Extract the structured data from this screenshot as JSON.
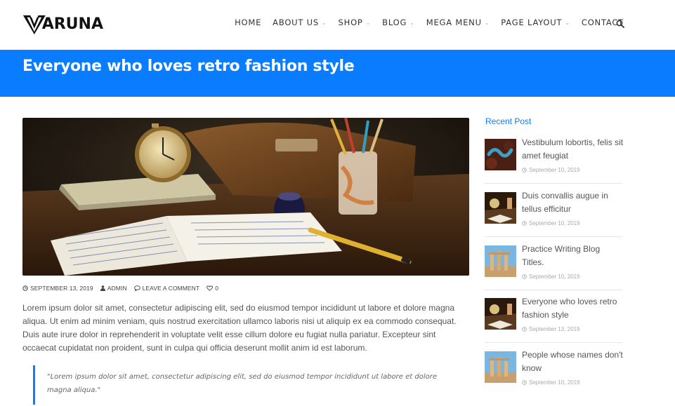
{
  "brand": {
    "name": "ARUNA"
  },
  "nav": [
    {
      "label": "HOME",
      "dropdown": false
    },
    {
      "label": "ABOUT US",
      "dropdown": true
    },
    {
      "label": "SHOP",
      "dropdown": true
    },
    {
      "label": "BLOG",
      "dropdown": true
    },
    {
      "label": "MEGA MENU",
      "dropdown": true
    },
    {
      "label": "PAGE LAYOUT",
      "dropdown": true
    },
    {
      "label": "CONTACT",
      "dropdown": false
    }
  ],
  "banner": {
    "title": "Everyone who loves retro fashion style"
  },
  "article": {
    "meta": {
      "date": "SEPTEMBER 13, 2019",
      "author": "ADMIN",
      "comment_link": "LEAVE A COMMENT",
      "likes": "0"
    },
    "body": "Lorem ipsum dolor sit amet, consectetur adipiscing elit, sed do eiusmod tempor incididunt ut labore et dolore magna aliqua. Ut enim ad minim veniam, quis nostrud exercitation ullamco laboris nisi ut aliquip ex ea commodo consequat. Duis aute irure dolor in reprehenderit in voluptate velit esse cillum dolore eu fugiat nulla pariatur. Excepteur sint occaecat cupidatat non proident, sunt in culpa qui officia deserunt mollit anim id est laborum.",
    "quote": "\"Lorem ipsum dolor sit amet, consectetur adipiscing elit, sed do eiusmod tempor incididunt ut labore et dolore magna aliqua.\""
  },
  "sidebar": {
    "title": "Recent Post",
    "posts": [
      {
        "title": "Vestibulum lobortis, felis sit amet feugiat",
        "date": "September 10, 2019",
        "thumb": "snake"
      },
      {
        "title": "Duis convallis augue in tellus efficitur",
        "date": "September 10, 2019",
        "thumb": "desk"
      },
      {
        "title": "Practice Writing Blog Titles.",
        "date": "September 10, 2019",
        "thumb": "ruins"
      },
      {
        "title": "Everyone who loves retro fashion style",
        "date": "September 13, 2019",
        "thumb": "desk"
      },
      {
        "title": "People whose names don't know",
        "date": "September 10, 2019",
        "thumb": "ruins"
      }
    ]
  },
  "colors": {
    "accent": "#0a7cff",
    "text": "#555555",
    "meta": "#aaaaaa"
  }
}
